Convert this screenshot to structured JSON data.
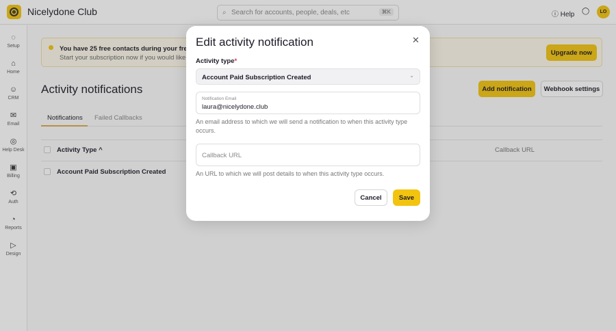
{
  "app": {
    "name": "Nicelydone Club",
    "search_placeholder": "Search for accounts, people, deals, etc",
    "search_shortcut": "⌘K",
    "help": "Help",
    "avatar": "LO"
  },
  "sidebar": {
    "items": [
      {
        "label": "Setup",
        "icon": "◌"
      },
      {
        "label": "Home",
        "icon": "⌂"
      },
      {
        "label": "CRM",
        "icon": "☺"
      },
      {
        "label": "Email",
        "icon": "✉"
      },
      {
        "label": "Help Desk",
        "icon": "◎"
      },
      {
        "label": "Billing",
        "icon": "▣"
      },
      {
        "label": "Auth",
        "icon": "⟲"
      },
      {
        "label": "Reports",
        "icon": "◔"
      },
      {
        "label": "Design",
        "icon": "▷"
      }
    ]
  },
  "banner": {
    "line1": "You have 25 free contacts during your free trial",
    "line2": "Start your subscription now if you would like to k",
    "upgrade": "Upgrade now"
  },
  "page": {
    "title": "Activity notifications",
    "add": "Add notification",
    "webhook": "Webhook settings",
    "tabs": [
      "Notifications",
      "Failed Callbacks"
    ],
    "table": {
      "headers": [
        "Activity Type ^",
        "Callback URL"
      ],
      "rows": [
        [
          "Account Paid Subscription Created"
        ]
      ]
    }
  },
  "modal": {
    "title": "Edit activity notification",
    "activity_label": "Activity type",
    "required": "*",
    "activity_value": "Account Paid Subscription Created",
    "email_label": "Notification Email",
    "email_value": "laura@nicelydone.club",
    "email_hint": "An email address to which we will send a notification to when this activity type occurs.",
    "callback_placeholder": "Callback URL",
    "callback_hint": "An URL to which we will post details to when this activity type occurs.",
    "cancel": "Cancel",
    "save": "Save"
  }
}
